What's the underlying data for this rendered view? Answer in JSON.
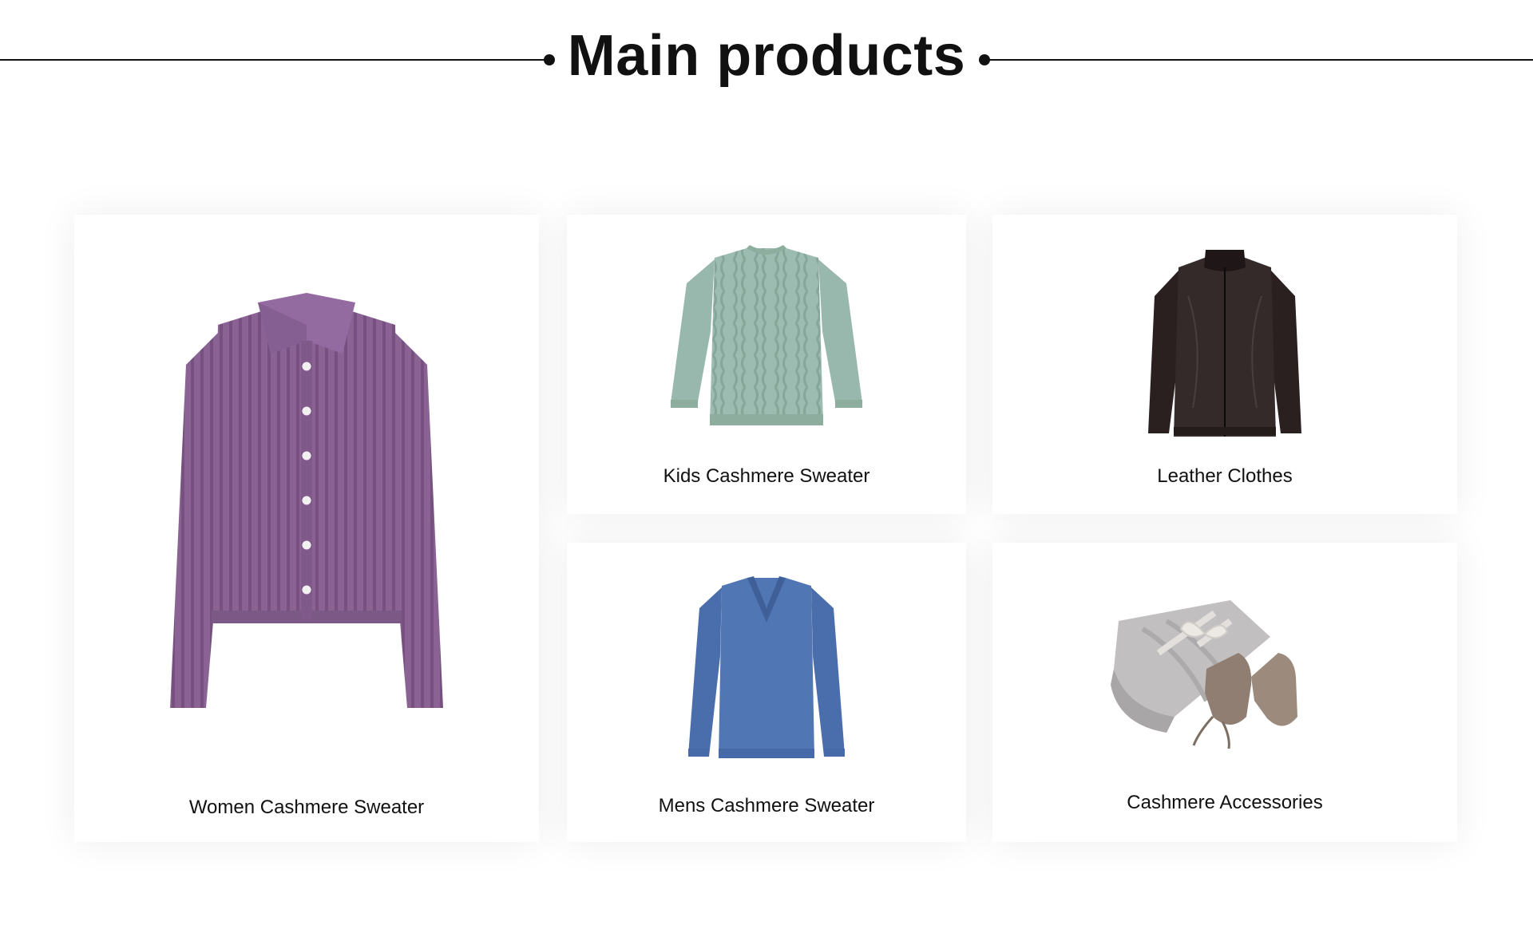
{
  "section": {
    "title": "Main products"
  },
  "products": [
    {
      "name": "Women Cashmere Sweater",
      "icon": "purple-cardigan-image",
      "color": "#8a6394"
    },
    {
      "name": "Kids Cashmere Sweater",
      "icon": "mint-cable-sweater-image",
      "color": "#9bb9ae"
    },
    {
      "name": "Leather Clothes",
      "icon": "black-leather-jacket-image",
      "color": "#2e2424"
    },
    {
      "name": "Mens Cashmere Sweater",
      "icon": "blue-vneck-sweater-image",
      "color": "#4f73b0"
    },
    {
      "name": "Cashmere Accessories",
      "icon": "blanket-and-booties-image",
      "color": "#b9b6b7"
    }
  ]
}
